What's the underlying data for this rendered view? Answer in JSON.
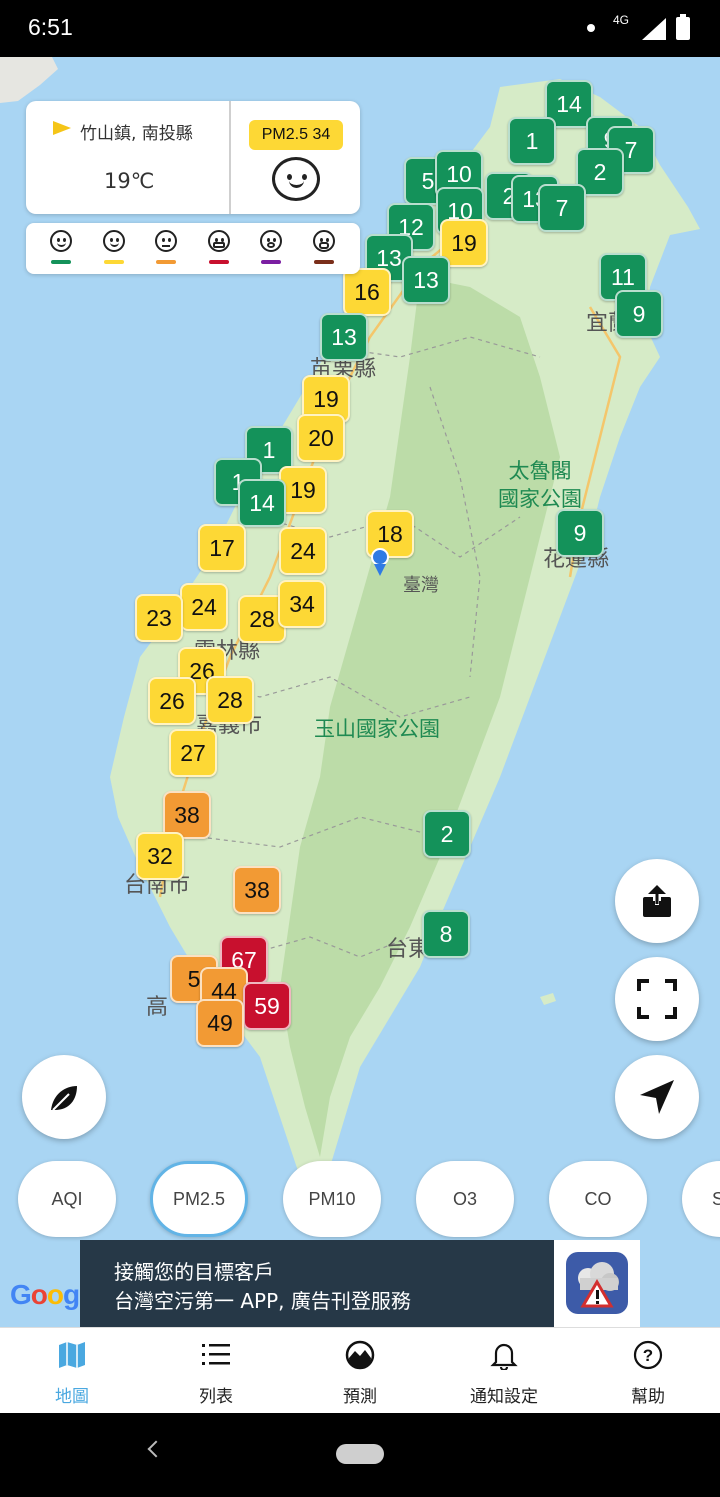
{
  "status_bar": {
    "time": "6:51",
    "network": "4G"
  },
  "info_card": {
    "location": "竹山鎮, 南投縣",
    "temperature": "19℃",
    "pm_label": "PM2.5 34"
  },
  "legend": {
    "levels": [
      {
        "icon": "good-face-icon",
        "color": "#14925a"
      },
      {
        "icon": "moderate-face-icon",
        "color": "#fdd835"
      },
      {
        "icon": "sensitive-face-icon",
        "color": "#f29a34"
      },
      {
        "icon": "unhealthy-mask-icon",
        "color": "#c8102e"
      },
      {
        "icon": "very-unhealthy-icon",
        "color": "#7b1fa2"
      },
      {
        "icon": "hazardous-gasmask-icon",
        "color": "#7a2e1a"
      }
    ]
  },
  "map_labels": {
    "yilan": "宜蘭",
    "taroko": "太魯閣\n國家公園",
    "hualien": "花蓮縣",
    "taiwan": "臺灣",
    "yushan": "玉山國家公園",
    "miaoli": "苗栗縣",
    "yunlin": "雲林縣",
    "chiayi": "嘉義市",
    "tainan": "台南市",
    "taitung": "台東",
    "kaohsiung": "高"
  },
  "markers": [
    {
      "value": "14",
      "level": "good"
    },
    {
      "value": "1",
      "level": "good"
    },
    {
      "value": "9",
      "level": "good"
    },
    {
      "value": "7",
      "level": "good"
    },
    {
      "value": "5",
      "level": "good"
    },
    {
      "value": "10",
      "level": "good"
    },
    {
      "value": "10",
      "level": "good"
    },
    {
      "value": "2",
      "level": "good"
    },
    {
      "value": "2",
      "level": "good"
    },
    {
      "value": "13",
      "level": "good"
    },
    {
      "value": "7",
      "level": "good"
    },
    {
      "value": "12",
      "level": "good"
    },
    {
      "value": "13",
      "level": "good"
    },
    {
      "value": "19",
      "level": "moderate"
    },
    {
      "value": "13",
      "level": "good"
    },
    {
      "value": "16",
      "level": "moderate"
    },
    {
      "value": "11",
      "level": "good"
    },
    {
      "value": "9",
      "level": "good"
    },
    {
      "value": "13",
      "level": "good"
    },
    {
      "value": "19",
      "level": "moderate"
    },
    {
      "value": "20",
      "level": "moderate"
    },
    {
      "value": "1",
      "level": "good"
    },
    {
      "value": "1",
      "level": "good"
    },
    {
      "value": "19",
      "level": "moderate"
    },
    {
      "value": "14",
      "level": "good"
    },
    {
      "value": "18",
      "level": "moderate"
    },
    {
      "value": "9",
      "level": "good"
    },
    {
      "value": "17",
      "level": "moderate"
    },
    {
      "value": "24",
      "level": "moderate"
    },
    {
      "value": "24",
      "level": "moderate"
    },
    {
      "value": "23",
      "level": "moderate"
    },
    {
      "value": "28",
      "level": "moderate"
    },
    {
      "value": "34",
      "level": "moderate"
    },
    {
      "value": "26",
      "level": "moderate"
    },
    {
      "value": "26",
      "level": "moderate"
    },
    {
      "value": "28",
      "level": "moderate"
    },
    {
      "value": "27",
      "level": "moderate"
    },
    {
      "value": "38",
      "level": "usg"
    },
    {
      "value": "2",
      "level": "good"
    },
    {
      "value": "32",
      "level": "moderate"
    },
    {
      "value": "38",
      "level": "usg"
    },
    {
      "value": "8",
      "level": "good"
    },
    {
      "value": "67",
      "level": "unhealthy"
    },
    {
      "value": "5",
      "level": "usg"
    },
    {
      "value": "44",
      "level": "usg"
    },
    {
      "value": "59",
      "level": "unhealthy"
    },
    {
      "value": "49",
      "level": "usg"
    }
  ],
  "buttons": {
    "share": "share-icon",
    "fullscreen": "fullscreen-icon",
    "locate": "navigation-arrow-icon",
    "layers": "leaf-icon"
  },
  "pollutant_tabs": [
    {
      "label": "AQI"
    },
    {
      "label": "PM2.5"
    },
    {
      "label": "PM10"
    },
    {
      "label": "O3"
    },
    {
      "label": "CO"
    },
    {
      "label": "S"
    }
  ],
  "ad": {
    "line1": "接觸您的目標客戶",
    "line2": "台灣空污第一 APP, 廣告刊登服務"
  },
  "google_logo": "Goog",
  "bottom_nav": [
    {
      "label": "地圖",
      "icon": "map-icon"
    },
    {
      "label": "列表",
      "icon": "list-icon"
    },
    {
      "label": "預測",
      "icon": "forecast-icon"
    },
    {
      "label": "通知設定",
      "icon": "bell-icon"
    },
    {
      "label": "幫助",
      "icon": "help-icon"
    }
  ]
}
